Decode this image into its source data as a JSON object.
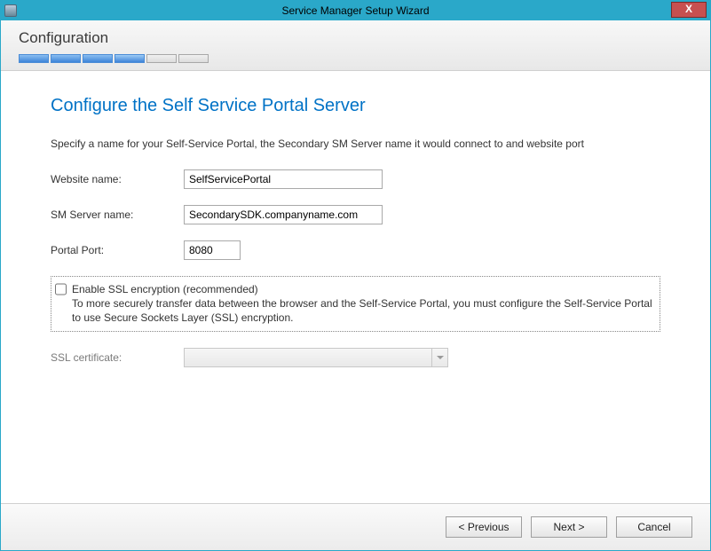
{
  "titlebar": {
    "title": "Service Manager Setup Wizard",
    "close": "X"
  },
  "header": {
    "section": "Configuration"
  },
  "page": {
    "title": "Configure the Self Service Portal Server",
    "instruction": "Specify a name for your Self-Service Portal, the Secondary SM Server name it would connect to and website port"
  },
  "form": {
    "websiteNameLabel": "Website name:",
    "websiteNameValue": "SelfServicePortal",
    "smServerLabel": "SM Server name:",
    "smServerValue": "SecondarySDK.companyname.com",
    "portLabel": "Portal Port:",
    "portValue": "8080",
    "sslTitle": "Enable SSL encryption (recommended)",
    "sslDesc": "To more securely transfer data between the browser and the Self-Service Portal, you must configure the Self-Service Portal to use Secure Sockets Layer (SSL) encryption.",
    "sslCertLabel": "SSL certificate:"
  },
  "footer": {
    "previous": "< Previous",
    "next": "Next >",
    "cancel": "Cancel"
  }
}
